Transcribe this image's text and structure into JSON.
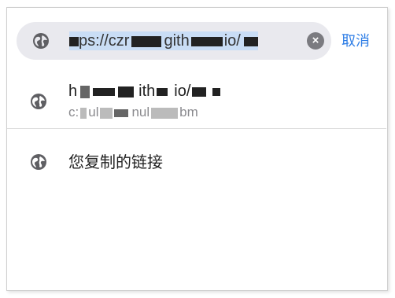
{
  "search": {
    "url_value": "ps://czr gith io/",
    "url_prefix": "",
    "url_mid": "ps://czr",
    "url_git": "gith",
    "url_end": "io/"
  },
  "cancel_label": "取消",
  "suggestions": [
    {
      "title_start": "h",
      "title_mid": "ith",
      "title_end": "io/",
      "subtitle_start": "c:",
      "subtitle_mid": "ul",
      "subtitle_mid2": "nul",
      "subtitle_end": "bm",
      "icon": "globe-icon"
    }
  ],
  "copied_link_label": "您复制的链接",
  "colors": {
    "accent": "#2f7ee6",
    "search_bg": "#e9e9ee",
    "selection": "#c9ddf5"
  }
}
